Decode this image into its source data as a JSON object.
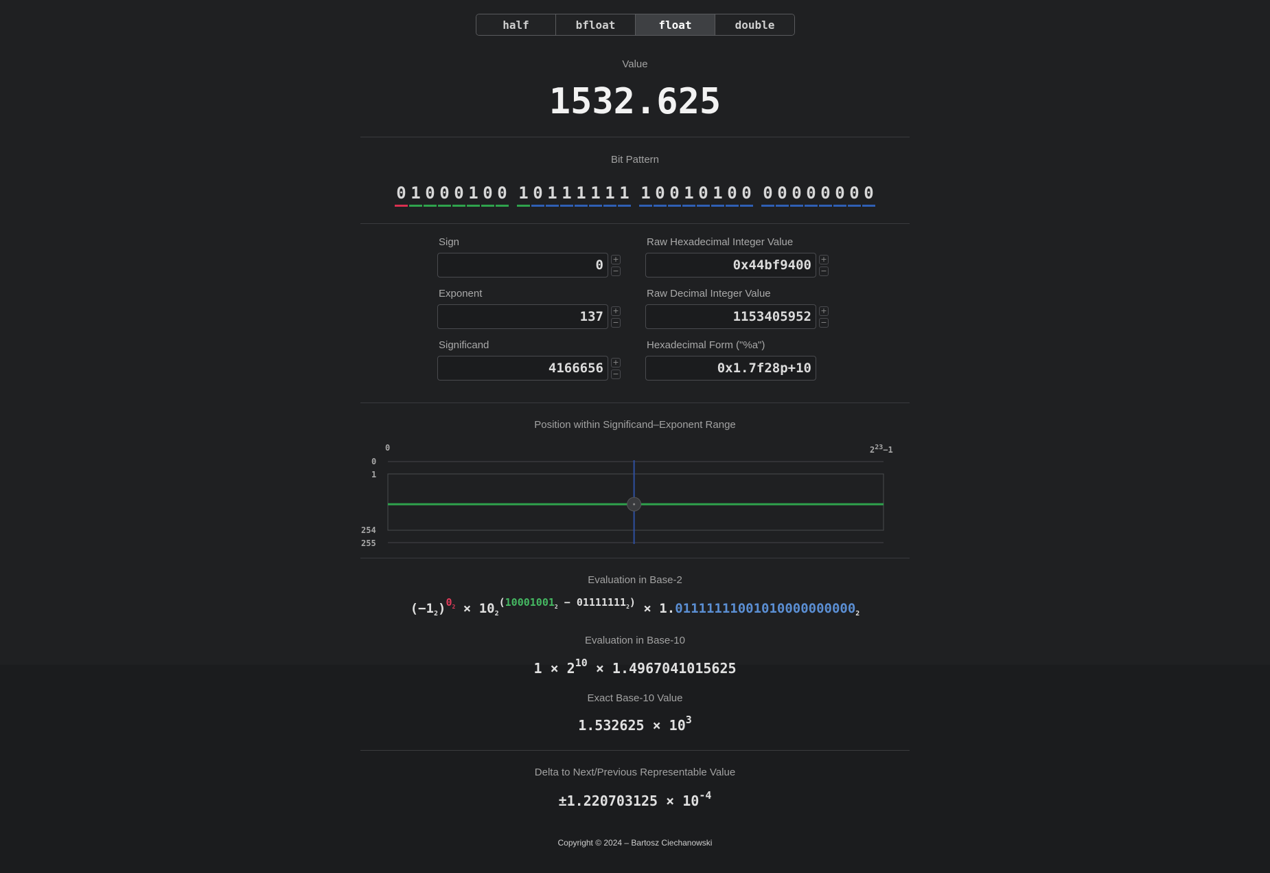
{
  "tabs": [
    "half",
    "bfloat",
    "float",
    "double"
  ],
  "active_tab": "float",
  "value": {
    "caption": "Value",
    "number": "1532.625"
  },
  "bit_pattern": {
    "caption": "Bit Pattern",
    "sign": "0",
    "exponent": "10001001",
    "significand": "01111111001010000000000"
  },
  "fields": {
    "sign": {
      "label": "Sign",
      "value": "0"
    },
    "exponent": {
      "label": "Exponent",
      "value": "137"
    },
    "significand": {
      "label": "Significand",
      "value": "4166656"
    },
    "raw_hex": {
      "label": "Raw Hexadecimal Integer Value",
      "value": "0x44bf9400"
    },
    "raw_dec": {
      "label": "Raw Decimal Integer Value",
      "value": "1153405952"
    },
    "hex_form": {
      "label": "Hexadecimal Form (\"%a\")",
      "value": "0x1.7f28p+10"
    }
  },
  "stepper": {
    "plus": "+",
    "minus": "−"
  },
  "range": {
    "caption": "Position within Significand–Exponent Range",
    "x_min_label": "0",
    "x_max_base": "2",
    "x_max_exp": "23",
    "x_max_suffix": "−1",
    "y_labels": [
      "0",
      "1",
      "254",
      "255"
    ],
    "significand_max": 8388607,
    "significand_value": 4166656,
    "exponent_value": 137,
    "exponent_max": 255,
    "colors": {
      "exponent_line": "#2fa34d",
      "significand_line": "#2f4fa0",
      "knob": "#3a3b3e"
    }
  },
  "base2": {
    "caption": "Evaluation in Base-2",
    "sign_base": "(−1",
    "sub2": "2",
    "close_paren": ")",
    "sign_exp": "0",
    "times": "×",
    "ten": "10",
    "open_paren": "(",
    "exp_bits": "10001001",
    "minus": " − ",
    "bias_bits": "01111111",
    "mant_prefix": "1.",
    "mant_bits": "01111111001010000000000"
  },
  "base10": {
    "caption": "Evaluation in Base-10",
    "lead": "1",
    "two": "2",
    "power": "10",
    "mantissa": "1.4967041015625"
  },
  "exact": {
    "caption": "Exact Base-10 Value",
    "mantissa": "1.532625",
    "ten": "10",
    "power": "3"
  },
  "delta": {
    "caption": "Delta to Next/Previous Representable Value",
    "mantissa": "±1.220703125",
    "ten": "10",
    "power": "-4"
  },
  "footer": "Copyright © 2024 – Bartosz Ciechanowski"
}
